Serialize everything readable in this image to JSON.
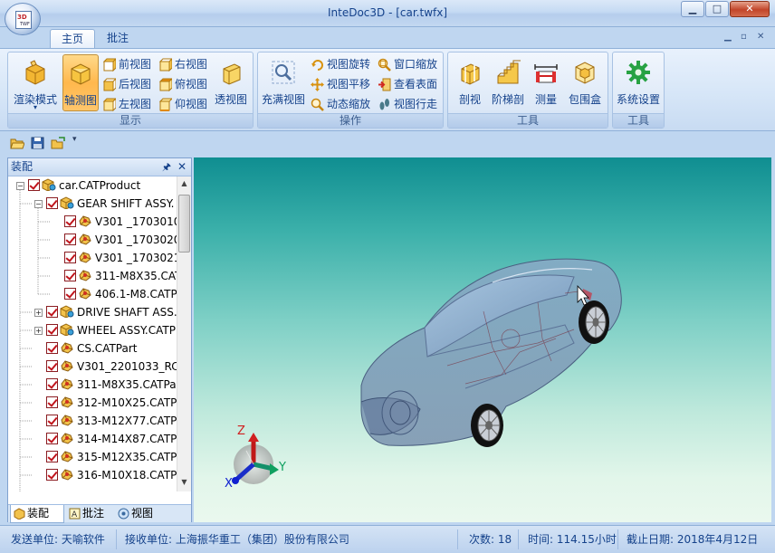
{
  "window": {
    "title": "InteDoc3D - [car.twfx]",
    "minimize_glyph": "▁",
    "maximize_glyph": "□",
    "close_glyph": "✕",
    "logo_mark": "3D",
    "logo_sub": "TWF"
  },
  "tabs": [
    {
      "label": "主页",
      "active": true
    },
    {
      "label": "批注",
      "active": false
    }
  ],
  "mdi": {
    "minimize": "▁",
    "restore": "▫",
    "close": "✕"
  },
  "ribbon": {
    "display": {
      "label": "显示",
      "render_mode": "渲染模式",
      "render_mode_arrow": "▾",
      "axis_view": "轴测图",
      "front": "前视图",
      "back": "后视图",
      "left": "左视图",
      "right": "右视图",
      "top": "俯视图",
      "bottom": "仰视图",
      "perspective": "透视图"
    },
    "operate": {
      "label": "操作",
      "fit": "充满视图",
      "rotate": "视图旋转",
      "pan": "视图平移",
      "dyn_zoom": "动态缩放",
      "window_zoom": "窗口缩放",
      "surface": "查看表面",
      "walk": "视图行走"
    },
    "tools": {
      "label": "工具",
      "section": "剖视",
      "stair_section": "阶梯剖",
      "measure": "测量",
      "bbox": "包围盒"
    },
    "tools2": {
      "label": "工具",
      "settings": "系统设置"
    }
  },
  "qat": {
    "more": "▾"
  },
  "assembly": {
    "title": "装配",
    "pin": "🖈",
    "close": "✕",
    "expand_collapsed": "+",
    "expand_open": "−",
    "scroll_up": "▲",
    "scroll_down": "▼",
    "tree": [
      {
        "label": "car.CATProduct",
        "level": 0,
        "expander": "−",
        "type": "product"
      },
      {
        "label": "GEAR SHIFT ASSY.",
        "level": 1,
        "expander": "−",
        "type": "product"
      },
      {
        "label": "V301 _1703010",
        "level": 2,
        "expander": "",
        "type": "part"
      },
      {
        "label": "V301 _1703020",
        "level": 2,
        "expander": "",
        "type": "part"
      },
      {
        "label": "V301 _1703021",
        "level": 2,
        "expander": "",
        "type": "part"
      },
      {
        "label": "311-M8X35.CAT",
        "level": 2,
        "expander": "",
        "type": "part"
      },
      {
        "label": "406.1-M8.CATP",
        "level": 2,
        "expander": "",
        "type": "part"
      },
      {
        "label": "DRIVE SHAFT ASS.",
        "level": 1,
        "expander": "+",
        "type": "product"
      },
      {
        "label": "WHEEL ASSY.CATP",
        "level": 1,
        "expander": "+",
        "type": "product"
      },
      {
        "label": "CS.CATPart",
        "level": 1,
        "expander": "",
        "type": "part"
      },
      {
        "label": "V301_2201033_RC",
        "level": 1,
        "expander": "",
        "type": "part"
      },
      {
        "label": "311-M8X35.CATPa",
        "level": 1,
        "expander": "",
        "type": "part"
      },
      {
        "label": "312-M10X25.CATP",
        "level": 1,
        "expander": "",
        "type": "part"
      },
      {
        "label": "313-M12X77.CATP",
        "level": 1,
        "expander": "",
        "type": "part"
      },
      {
        "label": "314-M14X87.CATP",
        "level": 1,
        "expander": "",
        "type": "part"
      },
      {
        "label": "315-M12X35.CATP",
        "level": 1,
        "expander": "",
        "type": "part"
      },
      {
        "label": "316-M10X18.CATP",
        "level": 1,
        "expander": "",
        "type": "part"
      }
    ],
    "tabs": [
      {
        "label": "装配",
        "active": true
      },
      {
        "label": "批注",
        "active": false
      },
      {
        "label": "视图",
        "active": false
      }
    ]
  },
  "viewport": {
    "axes": {
      "x": "X",
      "y": "Y",
      "z": "Z"
    },
    "colors": {
      "x": "#1020d0",
      "y": "#10a060",
      "z": "#d02020"
    }
  },
  "status": {
    "sender": "发送单位: 天喻软件",
    "receiver": "接收单位: 上海振华重工（集团）股份有限公司",
    "count": "次数: 18",
    "time": "时间: 114.15小时",
    "deadline": "截止日期: 2018年4月12日"
  }
}
